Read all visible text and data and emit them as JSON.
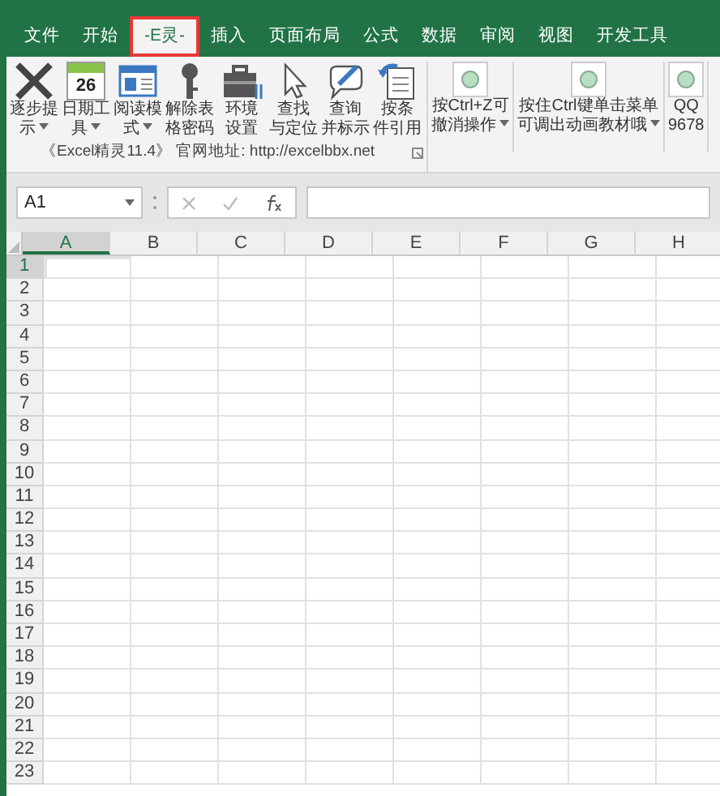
{
  "tabs": [
    {
      "label": "文件",
      "selected": false
    },
    {
      "label": "开始",
      "selected": false
    },
    {
      "label": "-E灵-",
      "selected": true
    },
    {
      "label": "插入",
      "selected": false
    },
    {
      "label": "页面布局",
      "selected": false
    },
    {
      "label": "公式",
      "selected": false
    },
    {
      "label": "数据",
      "selected": false
    },
    {
      "label": "审阅",
      "selected": false
    },
    {
      "label": "视图",
      "selected": false
    },
    {
      "label": "开发工具",
      "selected": false
    }
  ],
  "ribbon": {
    "tools": [
      {
        "kind": "cross",
        "lines": [
          "逐步提",
          "示"
        ],
        "dropdown": true
      },
      {
        "kind": "calendar",
        "day": "26",
        "lines": [
          "日期工",
          "具"
        ],
        "dropdown": true
      },
      {
        "kind": "card",
        "lines": [
          "阅读模",
          "式"
        ],
        "dropdown": true
      },
      {
        "kind": "key",
        "lines": [
          "解除表",
          "格密码"
        ],
        "dropdown": false
      },
      {
        "kind": "toolbox",
        "lines": [
          "环境",
          "设置"
        ],
        "dropdown": false
      },
      {
        "kind": "pointer",
        "lines": [
          "查找",
          "与定位"
        ],
        "dropdown": false
      },
      {
        "kind": "pen",
        "lines": [
          "查询",
          "并标示"
        ],
        "dropdown": false
      },
      {
        "kind": "undo",
        "lines": [
          "按条",
          "件引用"
        ],
        "dropdown": false
      }
    ],
    "group_label": "《Excel精灵11.4》 官网地址: http://excelbbx.net",
    "extra_buttons": [
      {
        "lines": [
          "按Ctrl+Z可",
          "撤消操作"
        ],
        "dropdown": true
      },
      {
        "lines": [
          "按住Ctrl键单击菜单",
          "可调出动画教材哦"
        ],
        "dropdown": true
      },
      {
        "lines": [
          "QQ",
          "9678"
        ],
        "dropdown": false
      }
    ]
  },
  "formula_bar": {
    "name_box": "A1"
  },
  "sheet": {
    "columns": [
      {
        "label": "A",
        "selected": true
      },
      {
        "label": "B",
        "selected": false
      },
      {
        "label": "C",
        "selected": false
      },
      {
        "label": "D",
        "selected": false
      },
      {
        "label": "E",
        "selected": false
      },
      {
        "label": "F",
        "selected": false
      },
      {
        "label": "G",
        "selected": false
      },
      {
        "label": "H",
        "selected": false
      }
    ],
    "rows": [
      {
        "label": "1",
        "selected": true
      },
      {
        "label": "2",
        "selected": false
      },
      {
        "label": "3",
        "selected": false
      },
      {
        "label": "4",
        "selected": false
      },
      {
        "label": "5",
        "selected": false
      },
      {
        "label": "6",
        "selected": false
      },
      {
        "label": "7",
        "selected": false
      },
      {
        "label": "8",
        "selected": false
      },
      {
        "label": "9",
        "selected": false
      },
      {
        "label": "10",
        "selected": false
      },
      {
        "label": "11",
        "selected": false
      },
      {
        "label": "12",
        "selected": false
      },
      {
        "label": "13",
        "selected": false
      },
      {
        "label": "14",
        "selected": false
      },
      {
        "label": "15",
        "selected": false
      },
      {
        "label": "16",
        "selected": false
      },
      {
        "label": "17",
        "selected": false
      },
      {
        "label": "18",
        "selected": false
      },
      {
        "label": "19",
        "selected": false
      },
      {
        "label": "20",
        "selected": false
      },
      {
        "label": "21",
        "selected": false
      },
      {
        "label": "22",
        "selected": false
      },
      {
        "label": "23",
        "selected": false
      }
    ]
  }
}
